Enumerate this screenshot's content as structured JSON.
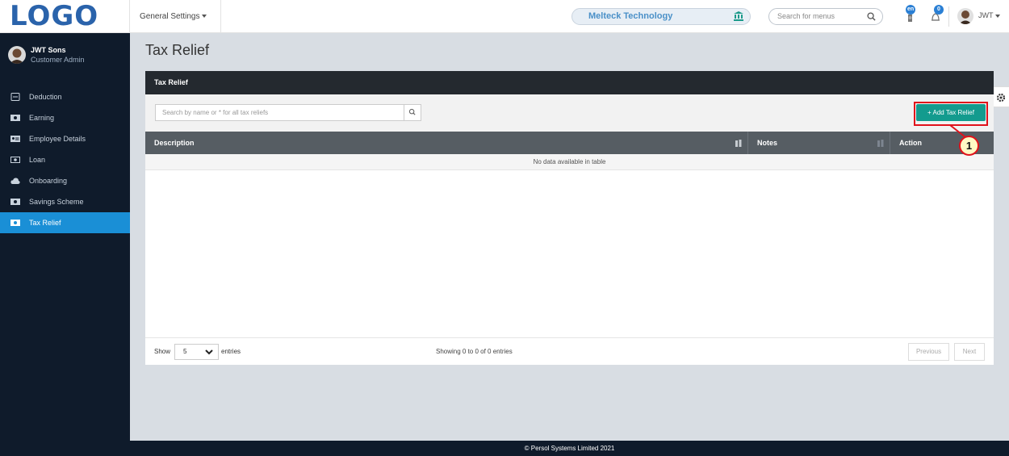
{
  "topbar": {
    "logo": "LOGO",
    "general_settings": "General Settings",
    "company": "Melteck Technology",
    "menu_search_placeholder": "Search for menus",
    "language_badge": "en",
    "notification_count": "0",
    "user": "JWT"
  },
  "sidebar": {
    "profile_name": "JWT Sons",
    "profile_role": "Customer Admin",
    "items": [
      {
        "label": "Deduction",
        "icon": "minus-box-icon"
      },
      {
        "label": "Earning",
        "icon": "money-icon"
      },
      {
        "label": "Employee Details",
        "icon": "id-card-icon"
      },
      {
        "label": "Loan",
        "icon": "cash-icon"
      },
      {
        "label": "Onboarding",
        "icon": "cloud-icon"
      },
      {
        "label": "Savings Scheme",
        "icon": "money-icon"
      },
      {
        "label": "Tax Relief",
        "icon": "money-icon",
        "active": true
      }
    ]
  },
  "main": {
    "page_title": "Tax Relief",
    "panel_title": "Tax Relief",
    "search_placeholder": "Search by name or * for all tax reliefs",
    "add_button": "+ Add Tax Relief",
    "columns": [
      "Description",
      "Notes",
      "Action"
    ],
    "empty_message": "No data available in table",
    "show_label": "Show",
    "page_length": "5",
    "entries_label": "entries",
    "info": "Showing 0 to 0 of 0 entries",
    "previous": "Previous",
    "next": "Next"
  },
  "callout": {
    "number": "1"
  },
  "footer": {
    "copyright": "© Persol Systems Limited 2021"
  },
  "colors": {
    "brand": "#2a63ab",
    "active": "#1a8fd6",
    "add_button": "#139b8e",
    "sidebar": "#0f1b2b",
    "highlight": "#e0121b"
  }
}
